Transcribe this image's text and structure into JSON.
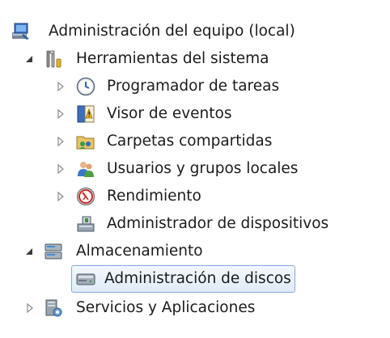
{
  "tree": {
    "root": {
      "label": "Administración del equipo (local)",
      "icon": "computer-management-icon"
    },
    "system_tools": {
      "label": "Herramientas del sistema",
      "icon": "tools-icon",
      "expanded": true,
      "children": [
        {
          "label": "Programador de tareas",
          "icon": "clock-icon"
        },
        {
          "label": "Visor de eventos",
          "icon": "event-viewer-icon"
        },
        {
          "label": "Carpetas compartidas",
          "icon": "shared-folders-icon"
        },
        {
          "label": "Usuarios y grupos locales",
          "icon": "users-icon"
        },
        {
          "label": "Rendimiento",
          "icon": "performance-icon"
        },
        {
          "label": "Administrador de dispositivos",
          "icon": "device-manager-icon"
        }
      ]
    },
    "storage": {
      "label": "Almacenamiento",
      "icon": "storage-icon",
      "expanded": true,
      "children": [
        {
          "label": "Administración de discos",
          "icon": "disk-icon",
          "selected": true
        }
      ]
    },
    "services": {
      "label": "Servicios y Aplicaciones",
      "icon": "services-icon",
      "expanded": false
    }
  },
  "colors": {
    "selection_border": "#84acdd",
    "selection_fill": "#dfecf9",
    "text": "#1b1b1b"
  }
}
